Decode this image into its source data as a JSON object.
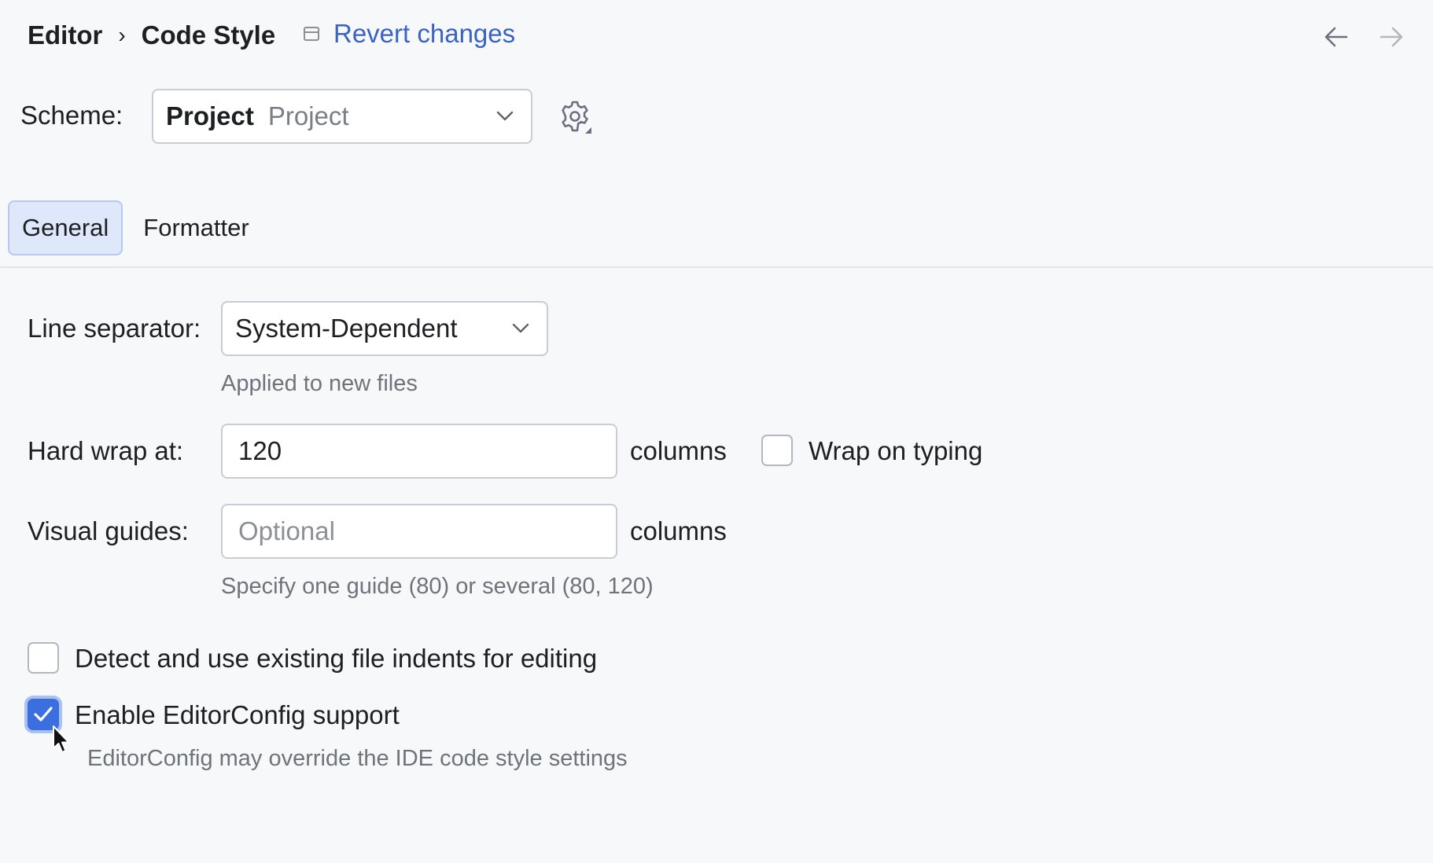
{
  "header": {
    "breadcrumb": [
      "Editor",
      "Code Style"
    ],
    "breadcrumb_separator": "›",
    "revert_label": "Revert changes",
    "back_icon": "arrow-left-icon",
    "forward_icon": "arrow-right-icon"
  },
  "scheme": {
    "label": "Scheme:",
    "selected_name": "Project",
    "selected_type": "Project",
    "settings_icon": "gear-icon"
  },
  "tabs": [
    {
      "label": "General",
      "selected": true
    },
    {
      "label": "Formatter",
      "selected": false
    }
  ],
  "general": {
    "line_separator": {
      "label": "Line separator:",
      "value": "System-Dependent",
      "hint": "Applied to new files"
    },
    "hard_wrap": {
      "label": "Hard wrap at:",
      "value": "120",
      "suffix": "columns",
      "wrap_on_typing_label": "Wrap on typing",
      "wrap_on_typing_checked": false
    },
    "visual_guides": {
      "label": "Visual guides:",
      "value": "",
      "placeholder": "Optional",
      "suffix": "columns",
      "hint": "Specify one guide (80) or several (80, 120)"
    },
    "detect_indents": {
      "label": "Detect and use existing file indents for editing",
      "checked": false
    },
    "editorconfig": {
      "label": "Enable EditorConfig support",
      "checked": true,
      "hint": "EditorConfig may override the IDE code style settings"
    }
  },
  "colors": {
    "accent": "#3b6fe0",
    "link": "#3a63c6",
    "background": "#f7f8fa",
    "tab_selected_bg": "#dfe8fb"
  }
}
